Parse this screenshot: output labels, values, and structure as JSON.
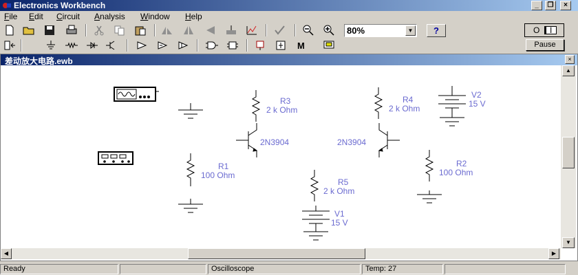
{
  "app": {
    "title": "Electronics Workbench",
    "window_controls": [
      "_",
      "❐",
      "×"
    ]
  },
  "menu": {
    "file": {
      "u": "F",
      "rest": "ile"
    },
    "edit": {
      "u": "E",
      "rest": "dit"
    },
    "circuit": {
      "u": "C",
      "rest": "ircuit"
    },
    "analysis": {
      "u": "A",
      "rest": "nalysis"
    },
    "window": {
      "u": "W",
      "rest": "indow"
    },
    "help": {
      "u": "H",
      "rest": "elp"
    }
  },
  "toolbar": {
    "zoom_value": "80%",
    "help_label": "?",
    "pause_label": "Pause",
    "power_off_label": "O",
    "power_on_label": "I"
  },
  "document": {
    "title": "差动放大电路.ewb",
    "close_label": "×"
  },
  "components": {
    "r3": {
      "name": "R3",
      "value": "2 k Ohm"
    },
    "r4": {
      "name": "R4",
      "value": "2 k Ohm"
    },
    "v2": {
      "name": "V2",
      "value": "15 V"
    },
    "q1": {
      "model": "2N3904"
    },
    "q2": {
      "model": "2N3904"
    },
    "r1": {
      "name": "R1",
      "value": "100  Ohm"
    },
    "r2": {
      "name": "R2",
      "value": "100  Ohm"
    },
    "r5": {
      "name": "R5",
      "value": "2 k Ohm"
    },
    "v1": {
      "name": "V1",
      "value": "15 V"
    }
  },
  "status": {
    "state": "Ready",
    "instrument": "Oscilloscope",
    "temp": "Temp:  27"
  },
  "colors": {
    "title_start": "#0a246a",
    "title_end": "#a6caf0",
    "label": "#6a6ad0",
    "face": "#d4d0c8"
  }
}
